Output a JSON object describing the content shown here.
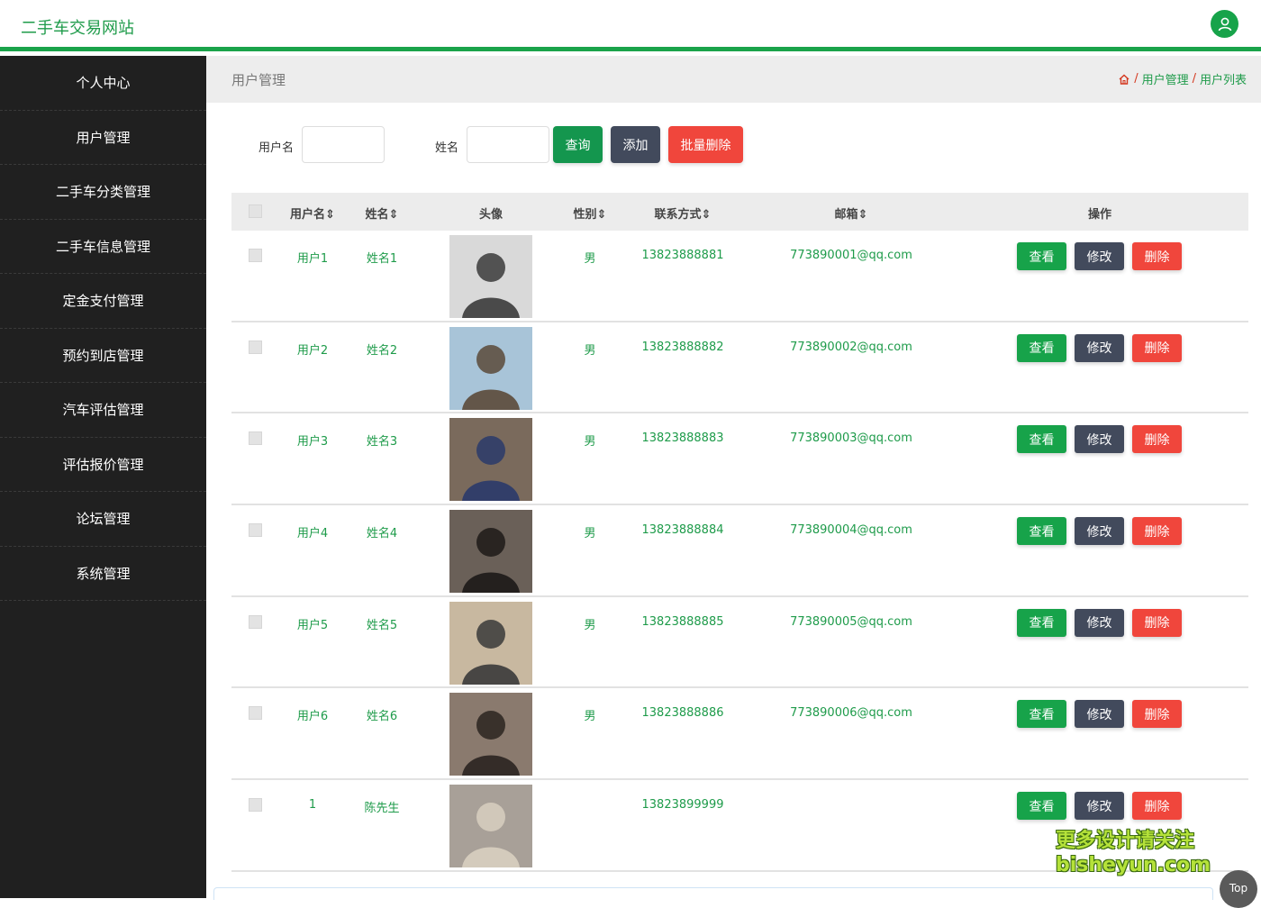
{
  "site_title": "二手车交易网站",
  "sidebar": {
    "items": [
      {
        "label": "个人中心"
      },
      {
        "label": "用户管理"
      },
      {
        "label": "二手车分类管理"
      },
      {
        "label": "二手车信息管理"
      },
      {
        "label": "定金支付管理"
      },
      {
        "label": "预约到店管理"
      },
      {
        "label": "汽车评估管理"
      },
      {
        "label": "评估报价管理"
      },
      {
        "label": "论坛管理"
      },
      {
        "label": "系统管理"
      }
    ]
  },
  "page": {
    "title": "用户管理",
    "breadcrumb": [
      "用户管理",
      "用户列表"
    ],
    "breadcrumb_sep": "/"
  },
  "search": {
    "username_label": "用户名",
    "username_value": "",
    "name_label": "姓名",
    "name_value": "",
    "query_label": "查询",
    "add_label": "添加",
    "batch_delete_label": "批量删除"
  },
  "table": {
    "headers": {
      "username": "用户名",
      "name": "姓名",
      "avatar": "头像",
      "gender": "性别",
      "phone": "联系方式",
      "email": "邮箱",
      "actions": "操作"
    },
    "rows": [
      {
        "username": "用户1",
        "name": "姓名1",
        "gender": "男",
        "phone": "13823888881",
        "email": "773890001@qq.com"
      },
      {
        "username": "用户2",
        "name": "姓名2",
        "gender": "男",
        "phone": "13823888882",
        "email": "773890002@qq.com"
      },
      {
        "username": "用户3",
        "name": "姓名3",
        "gender": "男",
        "phone": "13823888883",
        "email": "773890003@qq.com"
      },
      {
        "username": "用户4",
        "name": "姓名4",
        "gender": "男",
        "phone": "13823888884",
        "email": "773890004@qq.com"
      },
      {
        "username": "用户5",
        "name": "姓名5",
        "gender": "男",
        "phone": "13823888885",
        "email": "773890005@qq.com"
      },
      {
        "username": "用户6",
        "name": "姓名6",
        "gender": "男",
        "phone": "13823888886",
        "email": "773890006@qq.com"
      },
      {
        "username": "1",
        "name": "陈先生",
        "gender": "",
        "phone": "13823899999",
        "email": ""
      }
    ],
    "view_label": "查看",
    "edit_label": "修改",
    "delete_label": "删除"
  },
  "watermark": {
    "line1": "更多设计请关注",
    "line2": "bisheyun.com"
  },
  "top_label": "Top",
  "colors": {
    "accent": "#17a34a",
    "sidebar_bg": "#202020",
    "dark_button": "#424a5c",
    "danger": "#f0463c"
  }
}
